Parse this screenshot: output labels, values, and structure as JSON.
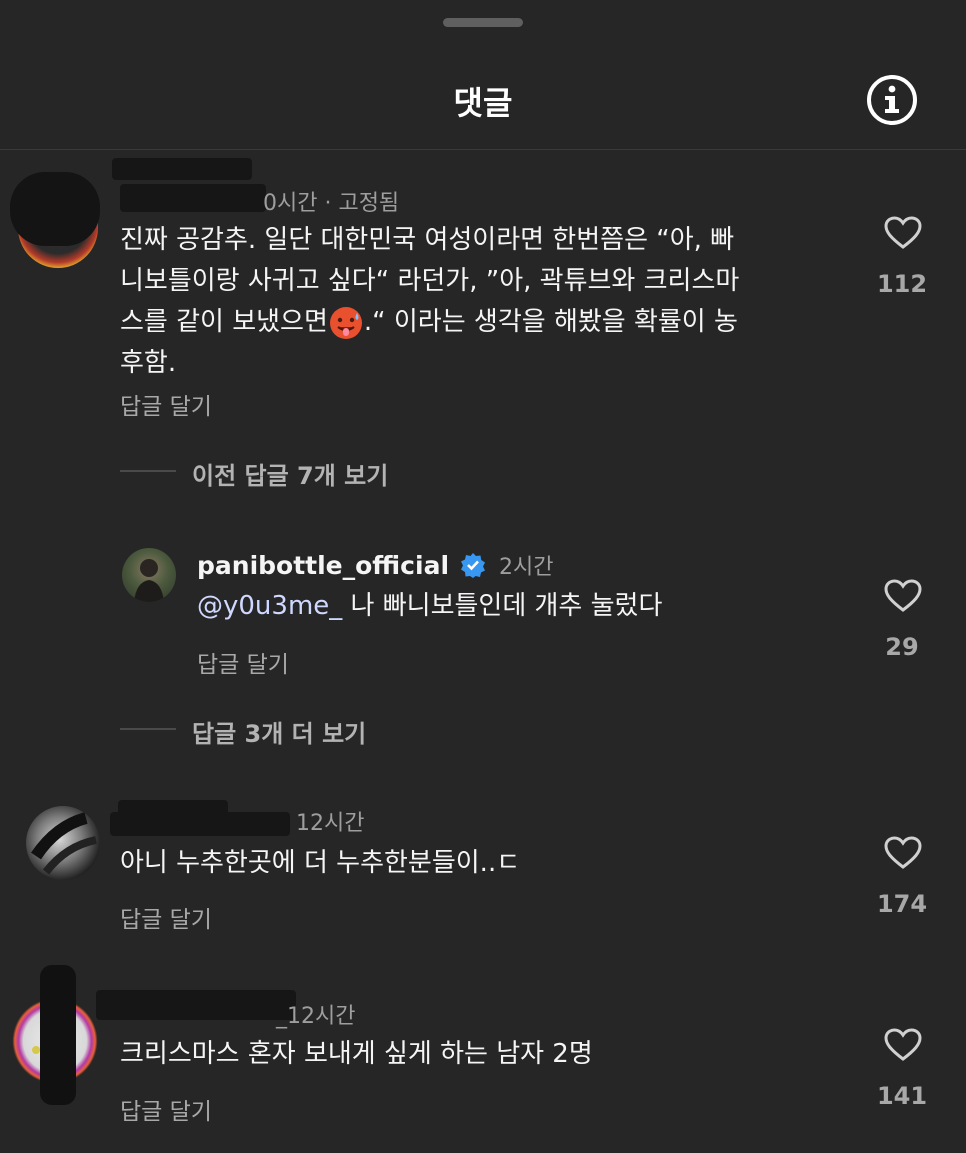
{
  "header": {
    "title": "댓글"
  },
  "comments": [
    {
      "meta": "0시간 · 고정됨",
      "text_lines": [
        "진짜 공감추. 일단 대한민국 여성이라면 한번쯤은 “아, 빠",
        "니보틀이랑 사귀고 싶다“ 라던가, ”아, 곽튜브와 크리스마",
        "스를 같이 보냈으면",
        "후함."
      ],
      "text_line3_tail": ".“ 이라는 생각을 해봤을 확률이 농",
      "reply_label": "답글 달기",
      "likes": "112",
      "thread_label": "이전 답글 7개 보기"
    },
    {
      "username": "panibottle_official",
      "time": "2시간",
      "mention": "@y0u3me_",
      "text": " 나 빠니보틀인데 개추 눌렀다",
      "reply_label": "답글 달기",
      "likes": "29",
      "thread_label": "답글 3개 더 보기"
    },
    {
      "meta": "12시간",
      "text": "아니 누추한곳에 더 누추한분들이..ㄷ",
      "reply_label": "답글 달기",
      "likes": "174"
    },
    {
      "meta": "12시간",
      "username_visible": "_",
      "text": "크리스마스 혼자 보내게 싶게 하는 남자 2명",
      "reply_label": "답글 달기",
      "likes": "141"
    }
  ],
  "colors": {
    "background": "#262626",
    "verified": "#3897f0"
  }
}
